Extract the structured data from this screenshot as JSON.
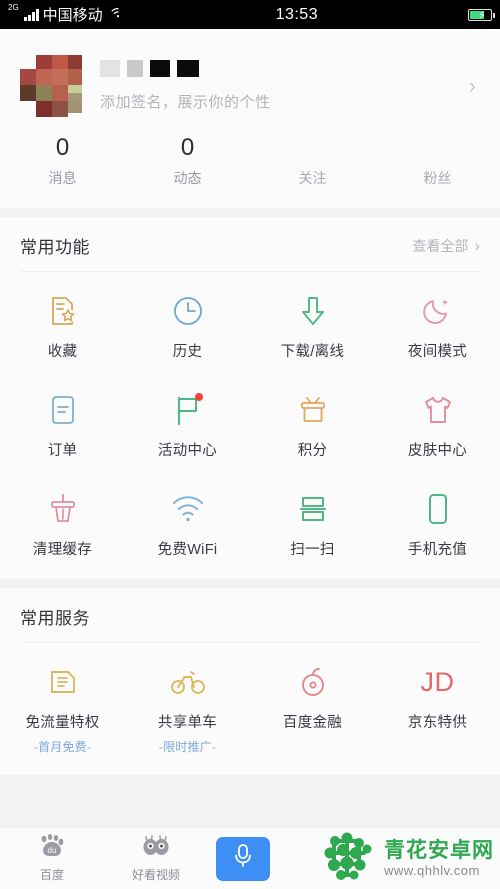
{
  "statusbar": {
    "network_tag": "2G",
    "carrier": "中国移动",
    "wifi_icon": "wifi-icon",
    "time": "13:53",
    "battery_icon": "battery-charging-icon"
  },
  "profile": {
    "avatar_label": "avatar-redacted",
    "username_redacted": "████  ███",
    "signature_placeholder": "添加签名，展示你的个性",
    "chevron": "›",
    "stats": [
      {
        "number": "0",
        "label": "消息"
      },
      {
        "number": "0",
        "label": "动态"
      },
      {
        "number": "",
        "label": "关注"
      },
      {
        "number": "",
        "label": "粉丝"
      }
    ]
  },
  "sections": [
    {
      "title": "常用功能",
      "more_label": "查看全部",
      "more_chevron": "›",
      "items": [
        {
          "label": "收藏",
          "icon": "bookmark-star-icon",
          "color": "#d7a85a",
          "badge": false
        },
        {
          "label": "历史",
          "icon": "clock-icon",
          "color": "#6fa8cf",
          "badge": false
        },
        {
          "label": "下载/离线",
          "icon": "download-arrow-icon",
          "color": "#4fb783",
          "badge": false
        },
        {
          "label": "夜间模式",
          "icon": "moon-star-icon",
          "color": "#e09aa6",
          "badge": false
        },
        {
          "label": "订单",
          "icon": "document-icon",
          "color": "#7fb0cd",
          "badge": false
        },
        {
          "label": "活动中心",
          "icon": "flag-icon",
          "color": "#4fb783",
          "badge": true
        },
        {
          "label": "积分",
          "icon": "gift-box-icon",
          "color": "#e3a85c",
          "badge": false
        },
        {
          "label": "皮肤中心",
          "icon": "tshirt-icon",
          "color": "#e48e9c",
          "badge": false
        },
        {
          "label": "清理缓存",
          "icon": "broom-icon",
          "color": "#e0909c",
          "badge": false
        },
        {
          "label": "免费WiFi",
          "icon": "wifi-icon",
          "color": "#7fb5d8",
          "badge": false
        },
        {
          "label": "扫一扫",
          "icon": "scan-icon",
          "color": "#4fb783",
          "badge": false
        },
        {
          "label": "手机充值",
          "icon": "phone-icon",
          "color": "#4fb783",
          "badge": false
        }
      ]
    },
    {
      "title": "常用服务",
      "more_label": "",
      "more_chevron": "",
      "items": [
        {
          "label": "免流量特权",
          "sub": "-首月免费-",
          "icon": "sim-card-icon",
          "color": "#dfb85e",
          "badge": false
        },
        {
          "label": "共享单车",
          "sub": "-限时推广-",
          "icon": "bicycle-icon",
          "color": "#dfb85e",
          "badge": false
        },
        {
          "label": "百度金融",
          "sub": "",
          "icon": "baidu-finance-icon",
          "color": "#e0888c",
          "badge": false
        },
        {
          "label": "京东特供",
          "sub": "",
          "icon": "jd-logo-icon",
          "color": "#e0696c",
          "badge": false
        }
      ]
    }
  ],
  "bottombar": {
    "items": [
      {
        "label": "百度",
        "icon": "baidu-paw-icon"
      },
      {
        "label": "好看视频",
        "icon": "haokan-eyes-icon"
      }
    ],
    "mic_icon": "microphone-icon",
    "mic_color": "#3d8ef5",
    "watermark": {
      "logo_icon": "qhhlv-logo-icon",
      "title": "青花安卓网",
      "url": "www.qhhlv.com",
      "color": "#2fa84f"
    }
  }
}
